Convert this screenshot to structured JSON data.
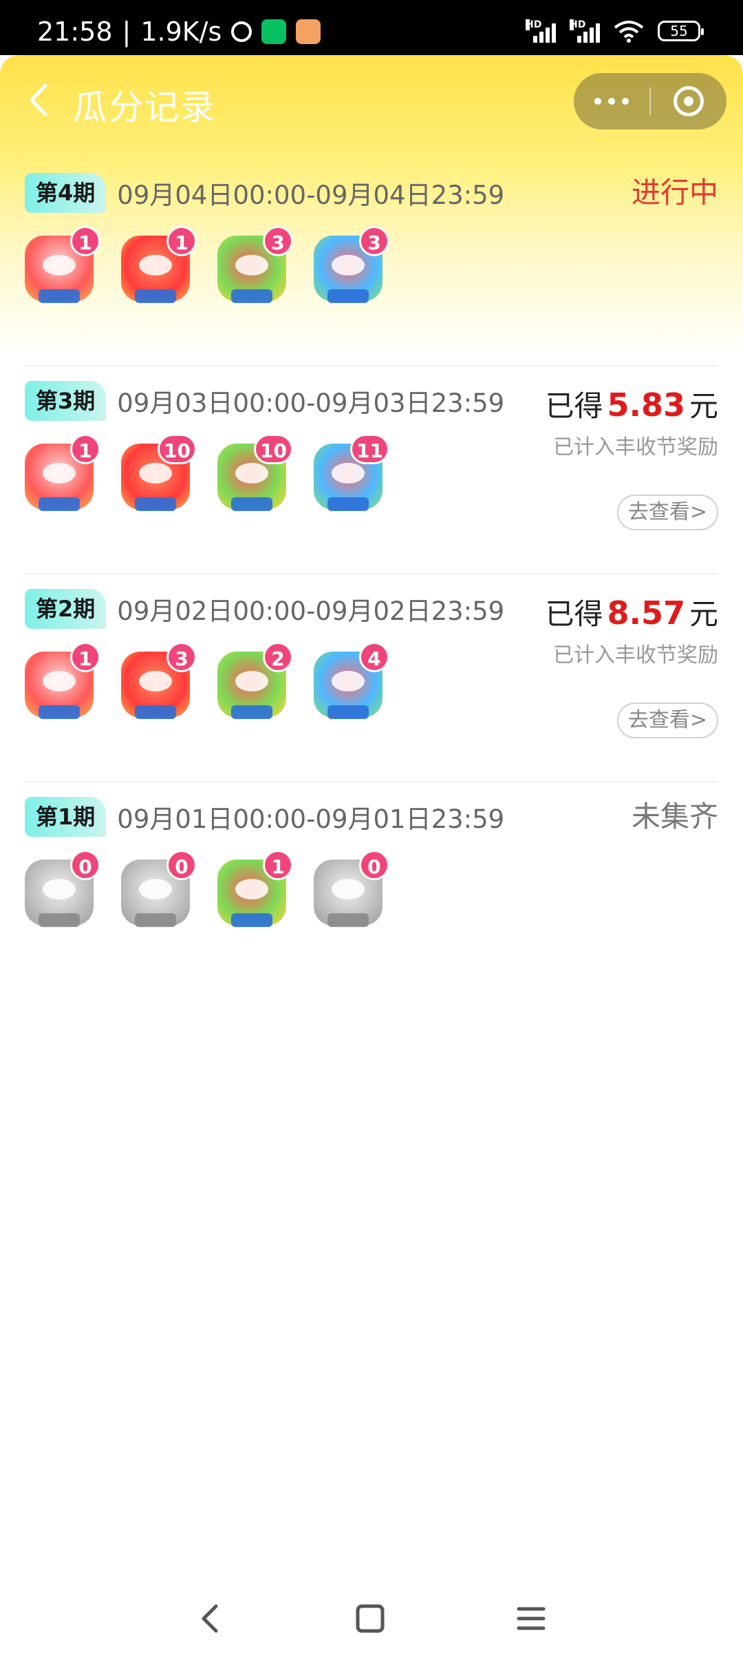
{
  "status_bar": {
    "time": "21:58",
    "net_speed": "1.9K/s",
    "battery": "55"
  },
  "header": {
    "title": "瓜分记录"
  },
  "records": [
    {
      "period": "第4期",
      "range": "09月04日00:00-09月04日23:59",
      "status": "进行中",
      "counts": [
        "1",
        "1",
        "3",
        "3"
      ]
    },
    {
      "period": "第3期",
      "range": "09月03日00:00-09月03日23:59",
      "reward_prefix": "已得",
      "amount": "5.83",
      "unit": "元",
      "note": "已计入丰收节奖励",
      "view_label": "去查看>",
      "counts": [
        "1",
        "10",
        "10",
        "11"
      ]
    },
    {
      "period": "第2期",
      "range": "09月02日00:00-09月02日23:59",
      "reward_prefix": "已得",
      "amount": "8.57",
      "unit": "元",
      "note": "已计入丰收节奖励",
      "view_label": "去查看>",
      "counts": [
        "1",
        "3",
        "2",
        "4"
      ]
    },
    {
      "period": "第1期",
      "range": "09月01日00:00-09月01日23:59",
      "status": "未集齐",
      "counts": [
        "0",
        "0",
        "1",
        "0"
      ]
    }
  ],
  "colors": {
    "accent_red": "#e01a1a",
    "badge_pink": "#f0457a",
    "header_yellow": "#ffe14a"
  }
}
